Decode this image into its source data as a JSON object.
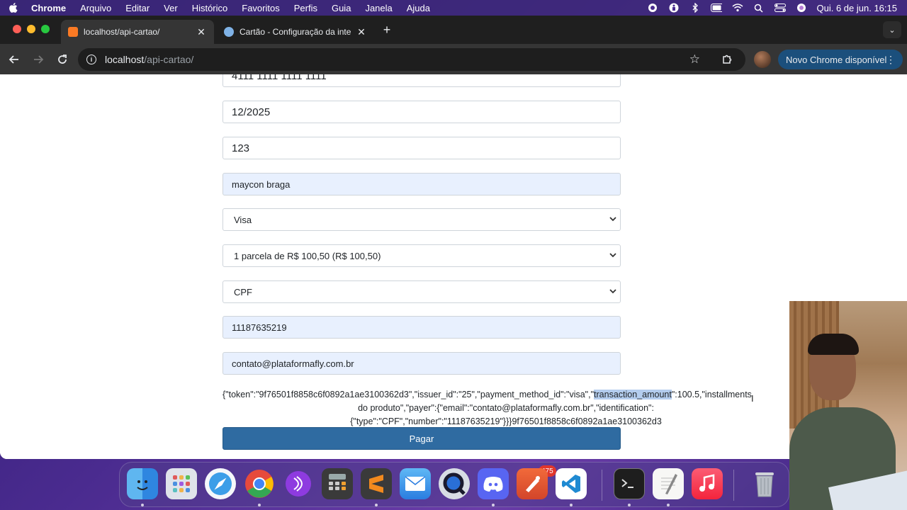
{
  "menubar": {
    "app_name": "Chrome",
    "items": [
      "Arquivo",
      "Editar",
      "Ver",
      "Histórico",
      "Favoritos",
      "Perfis",
      "Guia",
      "Janela",
      "Ajuda"
    ],
    "clock": "Qui. 6 de jun.  16:15"
  },
  "browser": {
    "tabs": [
      {
        "title": "localhost/api-cartao/",
        "active": true
      },
      {
        "title": "Cartão - Configuração da inte",
        "active": false
      }
    ],
    "url_host": "localhost",
    "url_path": "/api-cartao/",
    "update_label": "Novo Chrome disponível"
  },
  "form": {
    "card_number": "4111 1111 1111 1111",
    "expiration": "12/2025",
    "cvv": "123",
    "cardholder": "maycon braga",
    "issuer": "Visa",
    "installments": "1 parcela de R$ 100,50 (R$ 100,50)",
    "doc_type": "CPF",
    "doc_number": "11187635219",
    "email": "contato@plataformafly.com.br",
    "submit_label": "Pagar"
  },
  "output": {
    "line1_before": "{\"token\":\"9f76501f8858c6f0892a1ae3100362d3\",\"issuer_id\":\"25\",\"payment_method_id\":\"visa\",\"",
    "line1_highlight": "transaction_amount",
    "line1_after": "\":100.5,\"installments",
    "line2": "do produto\",\"payer\":{\"email\":\"contato@plataformafly.com.br\",\"identification\":",
    "line3": "{\"type\":\"CPF\",\"number\":\"11187635219\"}}}9f76501f8858c6f0892a1ae3100362d3"
  },
  "dock": {
    "mail_badge": "475",
    "apps": [
      "finder",
      "launchpad",
      "safari",
      "chrome",
      "podcasts-alt",
      "calculator",
      "sublime-text",
      "mail",
      "quicktime",
      "discord",
      "paw",
      "vscode",
      "terminal",
      "textedit",
      "music",
      "trash"
    ]
  },
  "colors": {
    "primary_button": "#2f6ba1",
    "autofill_bg": "#e8f0fe",
    "highlight": "#b4cdee"
  }
}
